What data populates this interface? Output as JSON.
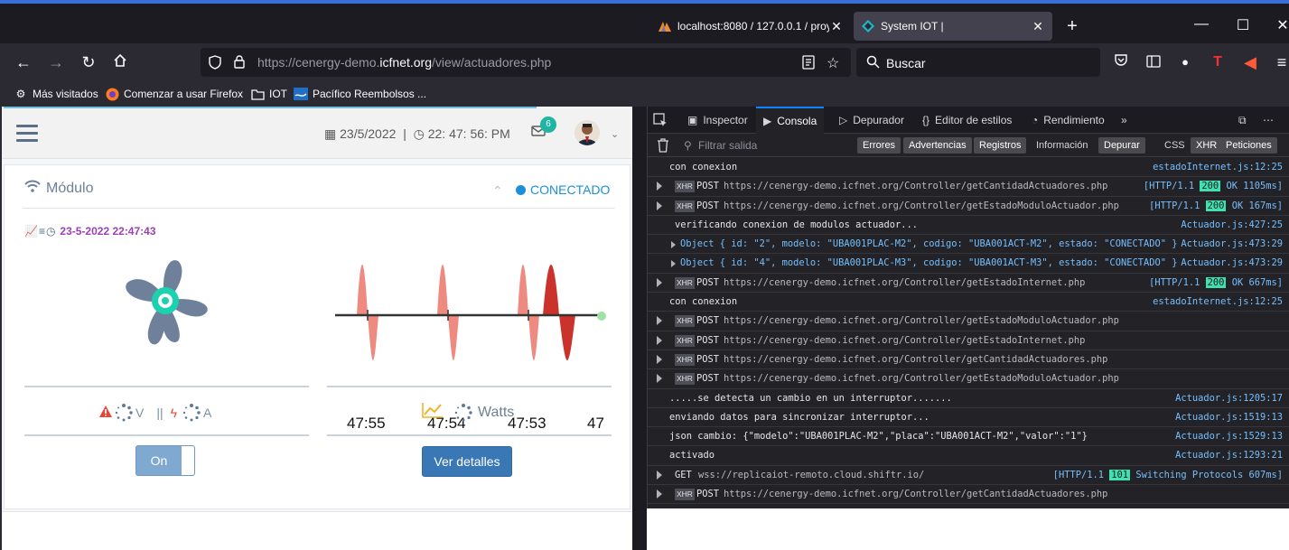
{
  "browser": {
    "tabs": [
      {
        "title": "localhost:8080 / 127.0.0.1 / proy",
        "active": false
      },
      {
        "title": "System IOT |",
        "active": true
      }
    ],
    "url": {
      "prefix": "https://cenergy-demo.",
      "domain": "icfnet.org",
      "path": "/view/actuadores.php"
    },
    "search_placeholder": "Buscar",
    "bookmarks": [
      {
        "label": "Más visitados",
        "icon": "gear-icon"
      },
      {
        "label": "Comenzar a usar Firefox",
        "icon": "firefox-icon"
      },
      {
        "label": "IOT",
        "icon": "folder-icon"
      },
      {
        "label": "Pacífico Reembolsos ...",
        "icon": "pacifico-icon"
      }
    ]
  },
  "app": {
    "date": "23/5/2022",
    "separator": "|",
    "time": "22: 47: 56: PM",
    "mail_count": "6",
    "card": {
      "title": "Módulo",
      "status": "CONECTADO",
      "timestamp": "23-5-2022 22:47:43",
      "chart_ticks": [
        "47:55",
        "47:54",
        "47:53",
        "47"
      ],
      "volt_unit": "V",
      "metric_sep": "||",
      "amp_unit": "A",
      "watts": "Watts",
      "toggle": "On",
      "details_button": "Ver detalles"
    }
  },
  "devtools": {
    "tabs": [
      "Inspector",
      "Consola",
      "Depurador",
      "Editor de estilos",
      "Rendimiento"
    ],
    "selected_tab": "Consola",
    "filter_placeholder": "Filtrar salida",
    "filters": [
      {
        "label": "Errores",
        "on": true
      },
      {
        "label": "Advertencias",
        "on": true
      },
      {
        "label": "Registros",
        "on": true
      },
      {
        "label": "Información",
        "on": false
      },
      {
        "label": "Depurar",
        "on": true
      },
      {
        "label": "CSS",
        "on": false
      },
      {
        "label": "XHR",
        "on": true
      },
      {
        "label": "Peticiones",
        "on": true
      }
    ],
    "log": [
      {
        "kind": "msg",
        "text": "con conexion",
        "src": "estadoInternet.js:12:25"
      },
      {
        "kind": "xhr",
        "method": "POST",
        "url": "https://cenergy-demo.icfnet.org/Controller/getCantidadActuadores.php",
        "proto": "[HTTP/1.1",
        "code": "200",
        "result": "OK 1105ms]"
      },
      {
        "kind": "xhr",
        "method": "POST",
        "url": "https://cenergy-demo.icfnet.org/Controller/getEstadoModuloActuador.php",
        "proto": "[HTTP/1.1",
        "code": "200",
        "result": "OK 167ms]"
      },
      {
        "kind": "msg2",
        "text": "verificando conexion de modulos actuador...",
        "src": "Actuador.js:427:25"
      },
      {
        "kind": "obj",
        "text": "Object { id: \"2\", modelo: \"UBA001PLAC-M2\", codigo: \"UBA001ACT-M2\", estado: \"CONECTADO\" }",
        "src": "Actuador.js:473:29"
      },
      {
        "kind": "obj",
        "text": "Object { id: \"4\", modelo: \"UBA001PLAC-M3\", codigo: \"UBA001ACT-M3\", estado: \"CONECTADO\" }",
        "src": "Actuador.js:473:29"
      },
      {
        "kind": "xhr",
        "method": "POST",
        "url": "https://cenergy-demo.icfnet.org/Controller/getEstadoInternet.php",
        "proto": "[HTTP/1.1",
        "code": "200",
        "result": "OK 667ms]"
      },
      {
        "kind": "msg",
        "text": "con conexion",
        "src": "estadoInternet.js:12:25"
      },
      {
        "kind": "xhr",
        "method": "POST",
        "url": "https://cenergy-demo.icfnet.org/Controller/getEstadoModuloActuador.php"
      },
      {
        "kind": "xhr",
        "method": "POST",
        "url": "https://cenergy-demo.icfnet.org/Controller/getEstadoInternet.php"
      },
      {
        "kind": "xhr",
        "method": "POST",
        "url": "https://cenergy-demo.icfnet.org/Controller/getCantidadActuadores.php"
      },
      {
        "kind": "xhr",
        "method": "POST",
        "url": "https://cenergy-demo.icfnet.org/Controller/getEstadoModuloActuador.php"
      },
      {
        "kind": "msg",
        "text": ".....se detecta un cambio en un interruptor.......",
        "src": "Actuador.js:1205:17"
      },
      {
        "kind": "msg",
        "text": "enviando datos para sincronizar interruptor...",
        "src": "Actuador.js:1519:13"
      },
      {
        "kind": "msg",
        "text": "json cambio: {\"modelo\":\"UBA001PLAC-M2\",\"placa\":\"UBA001ACT-M2\",\"valor\":\"1\"}",
        "src": "Actuador.js:1529:13"
      },
      {
        "kind": "msg",
        "text": "activado",
        "src": "Actuador.js:1293:21"
      },
      {
        "kind": "get",
        "method": "GET",
        "url": "wss://replicaiot-remoto.cloud.shiftr.io/",
        "proto": "[HTTP/1.1",
        "code": "101",
        "result": "Switching Protocols 607ms]"
      },
      {
        "kind": "xhr",
        "method": "POST",
        "url": "https://cenergy-demo.icfnet.org/Controller/getCantidadActuadores.php"
      }
    ]
  },
  "colors": {
    "accent": "#3a6fd8",
    "status_blue": "#1c8fd8",
    "timestamp_purple": "#9b3fb6",
    "fan_teal": "#1ad1b0",
    "wave_light": "#ef8a80",
    "wave_dark": "#c9332b"
  }
}
